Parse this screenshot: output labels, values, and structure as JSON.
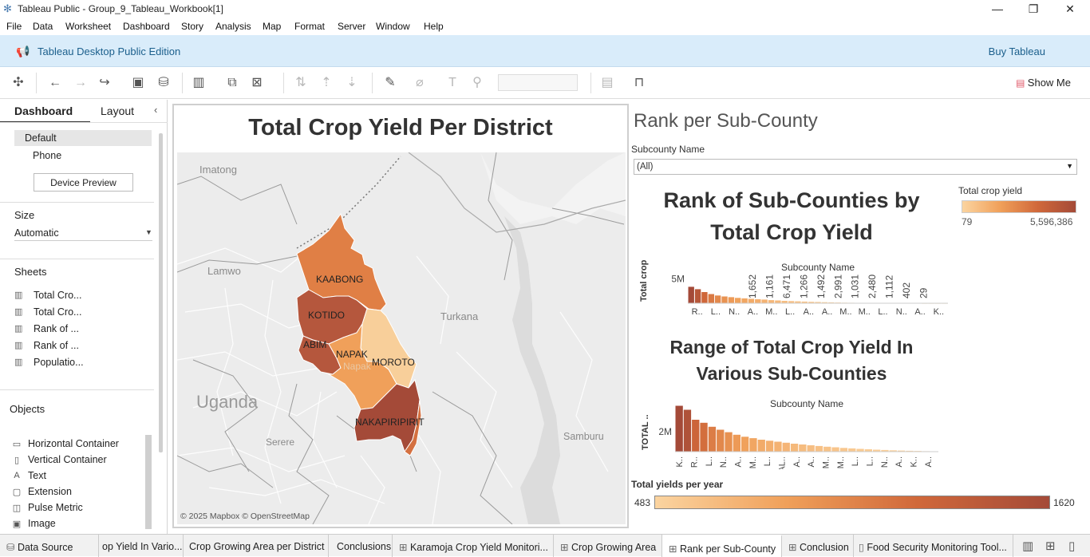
{
  "window": {
    "title": "Tableau Public - Group_9_Tableau_Workbook[1]"
  },
  "menu": [
    "File",
    "Data",
    "Worksheet",
    "Dashboard",
    "Story",
    "Analysis",
    "Map",
    "Format",
    "Server",
    "Window",
    "Help"
  ],
  "banner": {
    "edition": "Tableau Desktop Public Edition",
    "buy": "Buy Tableau"
  },
  "toolbar": {
    "show_me": "Show Me"
  },
  "left_pane": {
    "tabs": [
      "Dashboard",
      "Layout"
    ],
    "devices": [
      "Default",
      "Phone"
    ],
    "device_preview": "Device Preview",
    "size_heading": "Size",
    "size_value": "Automatic",
    "sheets_heading": "Sheets",
    "sheets": [
      "Total Cro...",
      "Total Cro...",
      "Rank of ...",
      "Rank of ...",
      "Populatio..."
    ],
    "objects_heading": "Objects",
    "objects": [
      "Horizontal Container",
      "Vertical Container",
      "Text",
      "Extension",
      "Pulse Metric",
      "Image"
    ]
  },
  "map_view": {
    "title": "Total Crop Yield Per District",
    "regions": [
      "Imatong",
      "Lamwo",
      "Turkana",
      "Uganda",
      "Serere",
      "Samburu",
      "Napak"
    ],
    "districts": [
      "KAABONG",
      "KOTIDO",
      "ABIM",
      "NAPAK",
      "MOROTO",
      "NAKAPIRIPIRIT"
    ],
    "attribution": "© 2025 Mapbox © OpenStreetMap",
    "colors": {
      "kaabong": "#e07f45",
      "kotido": "#b5573d",
      "abim": "#b5573d",
      "napak": "#f0a05a",
      "moroto": "#f8cf9a",
      "nakapiripirit": "#a44a38"
    }
  },
  "right": {
    "heading": "Rank per Sub-County",
    "filter_label": "Subcounty Name",
    "filter_value": "(All)",
    "legend_title": "Total crop yield",
    "legend_min": "79",
    "legend_max": "5,596,386",
    "chart1_title_line1": "Rank of Sub-Counties by",
    "chart1_title_line2": "Total Crop Yield",
    "chart2_title_line1": "Range of Total Crop Yield In",
    "chart2_title_line2": "Various Sub-Counties",
    "yearly_title": "Total yields per year",
    "yearly_min": "483",
    "yearly_max": "1620"
  },
  "chart_data": [
    {
      "type": "bar",
      "title": "Rank of Sub-Counties by Total Crop Yield",
      "xlabel": "Subcounty Name",
      "ylabel": "Total crop ..",
      "ytick": "5M",
      "ymax": 5.6,
      "values": [
        3.4,
        2.9,
        2.3,
        1.9,
        1.6,
        1.4,
        1.25,
        1.1,
        1.0,
        0.9,
        0.82,
        0.75,
        0.65,
        0.58,
        0.5,
        0.45,
        0.4,
        0.35,
        0.3,
        0.26,
        0.22,
        0.18,
        0.15,
        0.12,
        0.1,
        0.08,
        0.06,
        0.05,
        0.04,
        0.03,
        0.025,
        0.02,
        0.016,
        0.012,
        0.01,
        0.008,
        0.006,
        0.004,
        0.002
      ],
      "data_labels": [
        "1,652",
        "1,161",
        "6,471",
        "1,266",
        "1,492",
        "2,991",
        "1,031",
        "2,480",
        "1,112",
        "402",
        "29"
      ],
      "tick_labels": [
        "R..",
        "L..",
        "N..",
        "A..",
        "M..",
        "L..",
        "A..",
        "A..",
        "M..",
        "M..",
        "L..",
        "N..",
        "A..",
        "K.."
      ]
    },
    {
      "type": "bar",
      "title": "Range of Total Crop Yield In Various Sub-Counties",
      "xlabel": "Subcounty Name",
      "ylabel": "TOTAL ..",
      "ytick": "2M",
      "ymax": 4.0,
      "values": [
        4.6,
        4.2,
        3.2,
        2.9,
        2.5,
        2.2,
        1.95,
        1.7,
        1.5,
        1.35,
        1.2,
        1.1,
        1.0,
        0.9,
        0.8,
        0.72,
        0.64,
        0.57,
        0.5,
        0.44,
        0.38,
        0.33,
        0.28,
        0.24,
        0.2,
        0.17,
        0.14,
        0.11,
        0.09,
        0.07,
        0.05,
        0.03
      ],
      "tick_labels": [
        "K..",
        "R..",
        "L..",
        "N..",
        "A..",
        "M..",
        "L..",
        "AL..",
        "A..",
        "A..",
        "M..",
        "M..",
        "L..",
        "L..",
        "N..",
        "A..",
        "K..",
        "A.."
      ]
    }
  ],
  "bottom_tabs": [
    "Data Source",
    "op Yield In Vario...",
    "Crop Growing Area per District",
    "Conclusions",
    "Karamoja Crop Yield Monitori...",
    "Crop Growing Area",
    "Rank per Sub-County",
    "Conclusion",
    "Food Security Monitoring Tool..."
  ]
}
